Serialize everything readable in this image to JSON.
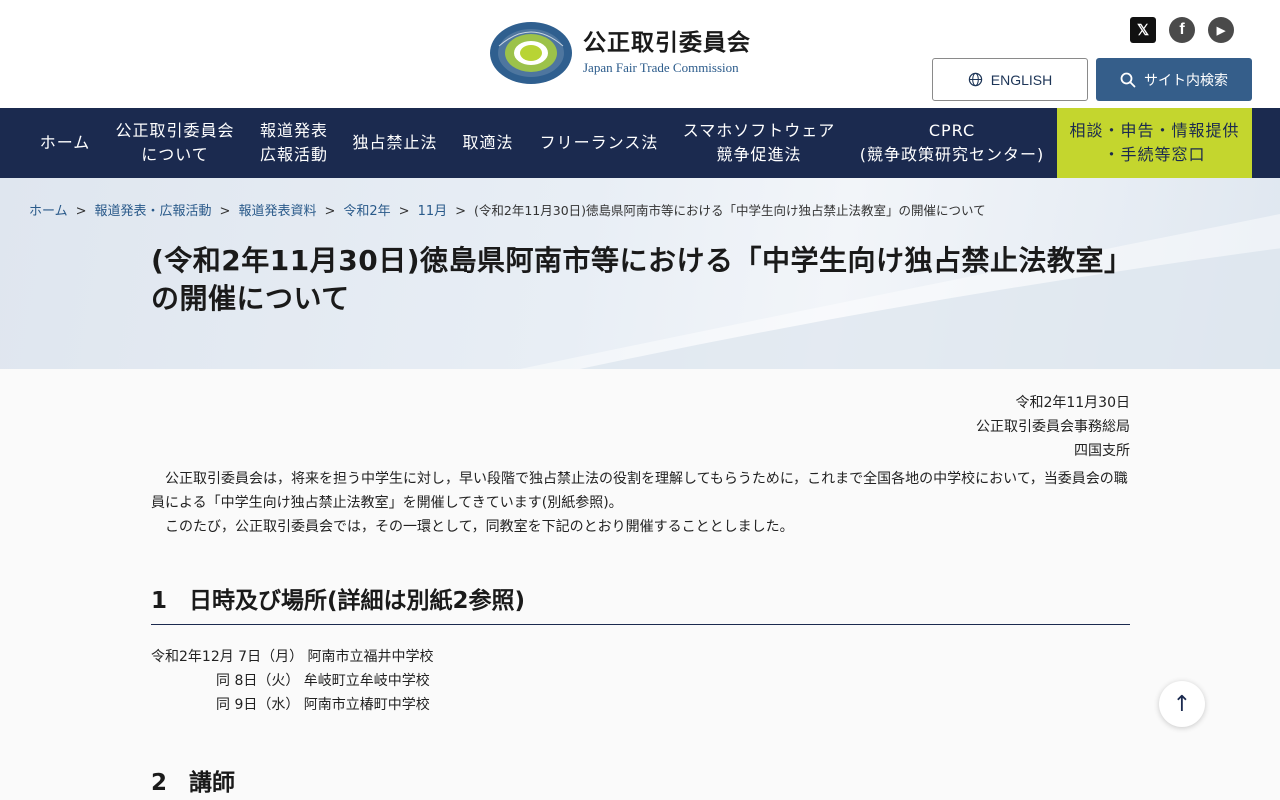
{
  "header": {
    "logo_ja": "公正取引委員会",
    "logo_en": "Japan Fair Trade Commission",
    "english_label": "ENGLISH",
    "search_label": "サイト内検索",
    "social": [
      {
        "icon": "x-icon",
        "glyph": "𝕏"
      },
      {
        "icon": "facebook-icon",
        "glyph": "f"
      },
      {
        "icon": "youtube-icon",
        "glyph": "▶"
      }
    ]
  },
  "nav": {
    "items": [
      {
        "line1": "ホーム",
        "line2": ""
      },
      {
        "line1": "公正取引委員会",
        "line2": "について"
      },
      {
        "line1": "報道発表",
        "line2": "広報活動"
      },
      {
        "line1": "独占禁止法",
        "line2": ""
      },
      {
        "line1": "取適法",
        "line2": ""
      },
      {
        "line1": "フリーランス法",
        "line2": ""
      },
      {
        "line1": "スマホソフトウェア",
        "line2": "競争促進法"
      },
      {
        "line1": "CPRC",
        "line2": "(競争政策研究センター)"
      },
      {
        "line1": "相談・申告・情報提供",
        "line2": "・手続等窓口"
      }
    ]
  },
  "breadcrumb": {
    "items": [
      "ホーム",
      "報道発表・広報活動",
      "報道発表資料",
      "令和2年",
      "11月"
    ],
    "current": "(令和2年11月30日)徳島県阿南市等における「中学生向け独占禁止法教室」の開催について",
    "separator": ">"
  },
  "page": {
    "title": "(令和2年11月30日)徳島県阿南市等における「中学生向け独占禁止法教室」の開催について",
    "date": "令和2年11月30日",
    "issuer1": "公正取引委員会事務総局",
    "issuer2": "四国支所",
    "intro1": "公正取引委員会は，将来を担う中学生に対し，早い段階で独占禁止法の役割を理解してもらうために，これまで全国各地の中学校において，当委員会の職員による「中学生向け独占禁止法教室」を開催してきています(別紙参照)。",
    "intro2": "このたび，公正取引委員会では，その一環として，同教室を下記のとおり開催することとしました。"
  },
  "sections": [
    {
      "num": "1",
      "title": "日時及び場所(詳細は別紙2参照)"
    },
    {
      "num": "2",
      "title": "講師"
    }
  ],
  "schedule": [
    "令和2年12月 7日（月） 阿南市立福井中学校",
    "同 8日（火） 牟岐町立牟岐中学校",
    "同 9日（水） 阿南市立椿町中学校"
  ],
  "back_to_top": "↑"
}
